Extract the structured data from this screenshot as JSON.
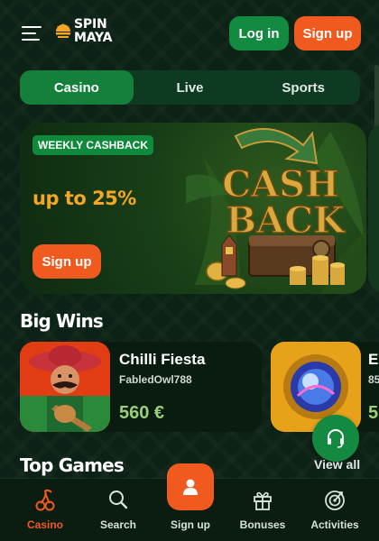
{
  "header": {
    "menu_icon": "hamburger-menu-icon",
    "logo_line1": "SPIN",
    "logo_line2": "MAYA",
    "login_label": "Log in",
    "signup_label": "Sign up"
  },
  "tabs": [
    {
      "label": "Casino",
      "active": true
    },
    {
      "label": "Live",
      "active": false
    },
    {
      "label": "Sports",
      "active": false
    }
  ],
  "promo": {
    "badge": "WEEKLY CASHBACK",
    "headline": "up to 25%",
    "button_label": "Sign up",
    "art_line1": "CASH",
    "art_line2": "BACK"
  },
  "big_wins": {
    "title": "Big Wins",
    "items": [
      {
        "game": "Chilli Fiesta",
        "user": "FabledOwl788",
        "amount": "560 €"
      },
      {
        "game": "E",
        "user": "85",
        "amount": "5"
      }
    ]
  },
  "top_games": {
    "title": "Top Games",
    "view_all": "View all"
  },
  "bottom_nav": [
    {
      "label": "Casino",
      "icon": "cherries-icon",
      "active": true
    },
    {
      "label": "Search",
      "icon": "search-icon",
      "active": false
    },
    {
      "label": "Sign up",
      "icon": "user-icon",
      "active": false
    },
    {
      "label": "Bonuses",
      "icon": "gift-icon",
      "active": false
    },
    {
      "label": "Activities",
      "icon": "target-icon",
      "active": false
    }
  ],
  "colors": {
    "accent_orange": "#f05a1e",
    "accent_green": "#138a3f",
    "promo_text": "#f5a623",
    "amount_green": "#9bd07a"
  }
}
